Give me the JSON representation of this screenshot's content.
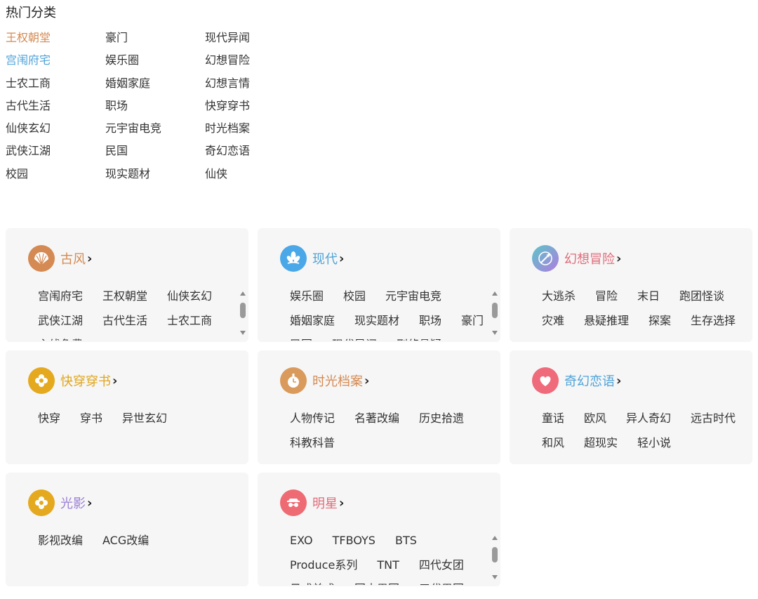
{
  "hot": {
    "title": "热门分类",
    "col1": [
      "王权朝堂",
      "宫闱府宅",
      "士农工商",
      "古代生活",
      "仙侠玄幻",
      "武侠江湖",
      "校园"
    ],
    "col2": [
      "豪门",
      "娱乐圈",
      "婚姻家庭",
      "职场",
      "元宇宙电竞",
      "民国",
      "现实题材"
    ],
    "col3": [
      "现代异闻",
      "幻想冒险",
      "幻想言情",
      "快穿穿书",
      "时光档案",
      "奇幻恋语",
      "仙侠"
    ]
  },
  "colors": {
    "accent_orange": "#d48a52",
    "accent_blue": "#4fa3d8",
    "card_bg": "#f6f6f6"
  },
  "cards": [
    {
      "title": "古风",
      "title_color": "#d48a52",
      "icon": "folding-fan-icon",
      "icon_color": "#d48a52",
      "tags": [
        "宫闱府宅",
        "王权朝堂",
        "仙侠玄幻",
        "武侠江湖",
        "古代生活",
        "士农工商",
        "主线免费"
      ]
    },
    {
      "title": "现代",
      "title_color": "#4fa3d8",
      "icon": "lotus-icon",
      "icon_color": "#4aa8e8",
      "tags": [
        "娱乐圈",
        "校园",
        "元宇宙电竞",
        "婚姻家庭",
        "现实题材",
        "职场",
        "豪门",
        "民国",
        "现代异闻",
        "刑侦悬疑"
      ]
    },
    {
      "title": "幻想冒险",
      "title_color": "#e06c7a",
      "icon": "magic-wand-icon",
      "icon_color": "#5bc6c8",
      "tags": [
        "大逃杀",
        "冒险",
        "末日",
        "跑团怪谈",
        "灾难",
        "悬疑推理",
        "探案",
        "生存选择"
      ]
    },
    {
      "title": "快穿穿书",
      "title_color": "#e0a51c",
      "icon": "flower-icon",
      "icon_color": "#e5a91f",
      "tags": [
        "快穿",
        "穿书",
        "异世玄幻"
      ]
    },
    {
      "title": "时光档案",
      "title_color": "#d48a52",
      "icon": "pocket-watch-icon",
      "icon_color": "#d99a5c",
      "tags": [
        "人物传记",
        "名著改编",
        "历史拾遗",
        "科教科普"
      ]
    },
    {
      "title": "奇幻恋语",
      "title_color": "#4fa3d8",
      "icon": "heart-icon",
      "icon_color": "#ef6a7a",
      "tags": [
        "童话",
        "欧风",
        "异人奇幻",
        "远古时代",
        "和风",
        "超现实",
        "轻小说"
      ]
    },
    {
      "title": "光影",
      "title_color": "#9b7fd6",
      "icon": "flower-icon",
      "icon_color": "#e5a91f",
      "tags": [
        "影视改编",
        "ACG改编"
      ]
    },
    {
      "title": "明星",
      "title_color": "#e06c7a",
      "icon": "star-face-icon",
      "icon_color": "#ee6b73",
      "tags": [
        "EXO",
        "TFBOYS",
        "BTS",
        "Produce系列",
        "TNT",
        "四代女团",
        "日式美成",
        "国内男团",
        "三代男团"
      ]
    }
  ]
}
